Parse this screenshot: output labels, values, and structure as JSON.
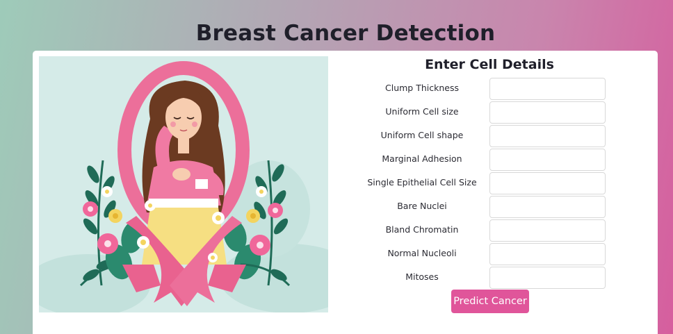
{
  "page_title": "Breast Cancer Detection",
  "illustration": {
    "icon": "breast-cancer-awareness-ribbon-woman",
    "colors": {
      "background": "#d5ebe8",
      "ribbon": "#ec6f9a",
      "ribbon_dark": "#d94f80",
      "shirt": "#f07aa3",
      "skirt": "#f6df82",
      "hair": "#6b3a21",
      "skin": "#f7cdb0",
      "leaf": "#1f6b57",
      "flower_pink": "#f0679a",
      "flower_yellow": "#f3d45f"
    }
  },
  "form": {
    "title": "Enter Cell Details",
    "fields": [
      {
        "label": "Clump Thickness",
        "value": ""
      },
      {
        "label": "Uniform Cell size",
        "value": ""
      },
      {
        "label": "Uniform Cell shape",
        "value": ""
      },
      {
        "label": "Marginal Adhesion",
        "value": ""
      },
      {
        "label": "Single Epithelial Cell Size",
        "value": ""
      },
      {
        "label": "Bare Nuclei",
        "value": ""
      },
      {
        "label": "Bland Chromatin",
        "value": ""
      },
      {
        "label": "Normal Nucleoli",
        "value": ""
      },
      {
        "label": "Mitoses",
        "value": ""
      }
    ],
    "submit_label": "Predict Cancer",
    "accent_color": "#e0559a"
  }
}
